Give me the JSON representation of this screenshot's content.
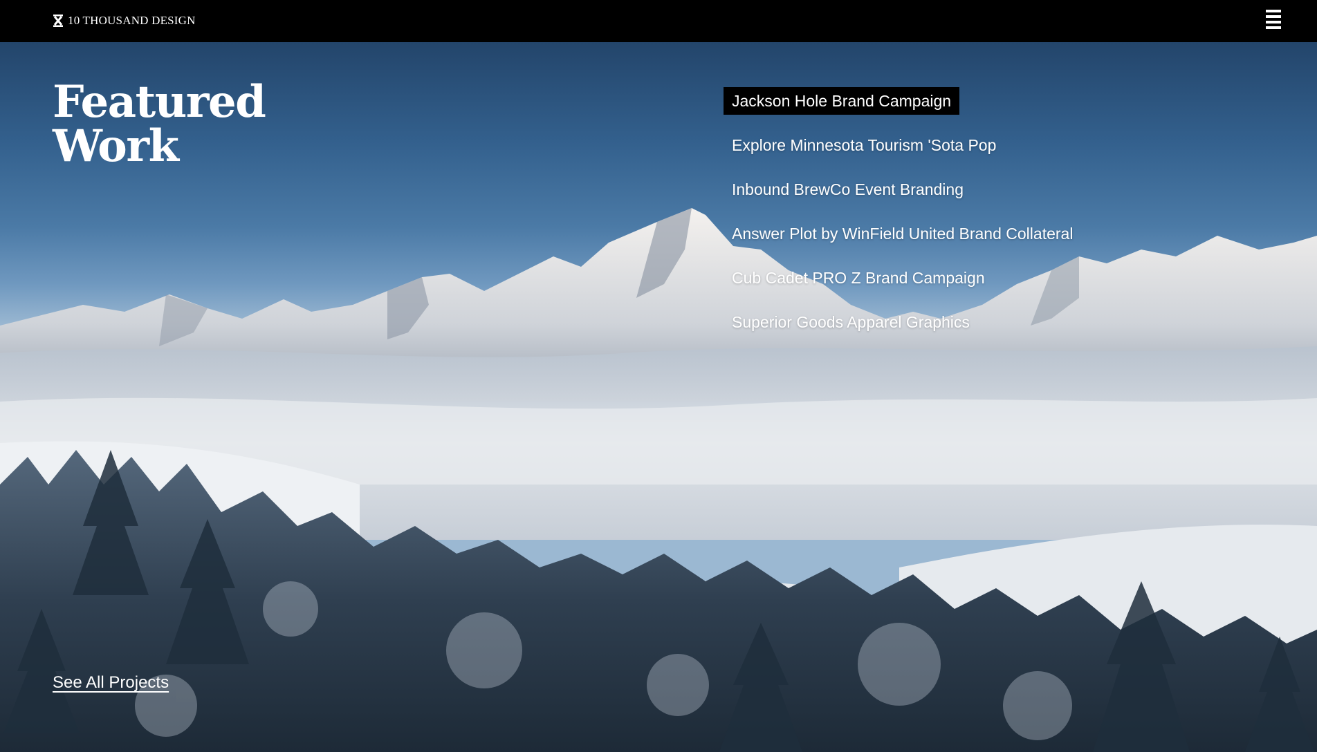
{
  "header": {
    "logo_text": "10 THOUSAND DESIGN",
    "logo_icon": "x-mark-icon",
    "menu_icon": "hamburger-menu-icon"
  },
  "hero": {
    "title_line1": "Featured",
    "title_line2": "Work",
    "background": "snowy-mountain-landscape"
  },
  "projects": [
    {
      "label": "Jackson Hole Brand Campaign",
      "active": true
    },
    {
      "label": "Explore Minnesota Tourism 'Sota Pop",
      "active": false
    },
    {
      "label": "Inbound BrewCo Event Branding",
      "active": false
    },
    {
      "label": "Answer Plot by WinField United Brand Collateral",
      "active": false
    },
    {
      "label": "Cub Cadet PRO Z Brand Campaign",
      "active": false
    },
    {
      "label": "Superior Goods Apparel Graphics",
      "active": false
    }
  ],
  "footer_link": {
    "label": "See All Projects"
  },
  "colors": {
    "topbar": "#000000",
    "text": "#ffffff",
    "active_highlight": "#000000",
    "sky": "#33608d"
  }
}
